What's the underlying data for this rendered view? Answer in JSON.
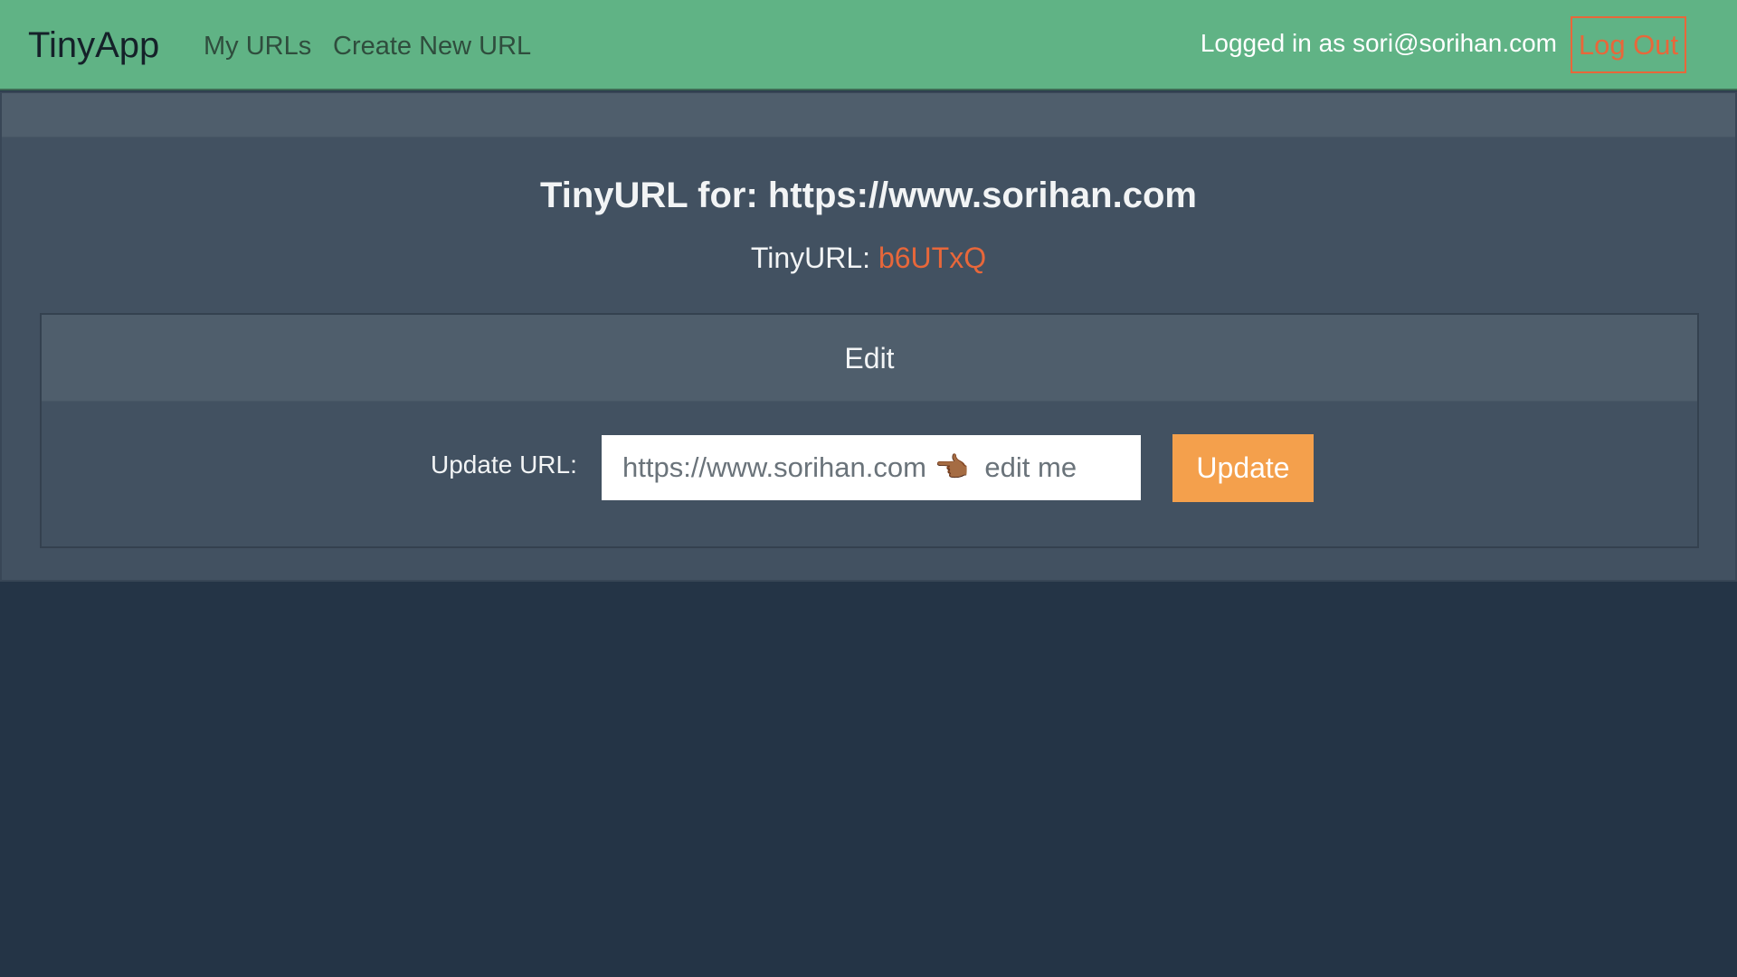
{
  "navbar": {
    "brand": "TinyApp",
    "links": [
      {
        "label": "My URLs"
      },
      {
        "label": "Create New URL"
      }
    ],
    "logged_in_text": "Logged in as sori@sorihan.com",
    "logout_label": "Log Out"
  },
  "main": {
    "title": "TinyURL for: https://www.sorihan.com",
    "tinyurl_label": "TinyURL: ",
    "tinyurl_code": "b6UTxQ",
    "edit_panel": {
      "header": "Edit",
      "field_label": "Update URL:",
      "input_placeholder": "https://www.sorihan.com 👈🏾  edit me",
      "button_label": "Update"
    }
  },
  "colors": {
    "navbar_bg": "#60b385",
    "page_bg": "#243446",
    "card_bg": "#425161",
    "accent_orange": "#e8673a",
    "button_orange": "#f4a04c"
  }
}
